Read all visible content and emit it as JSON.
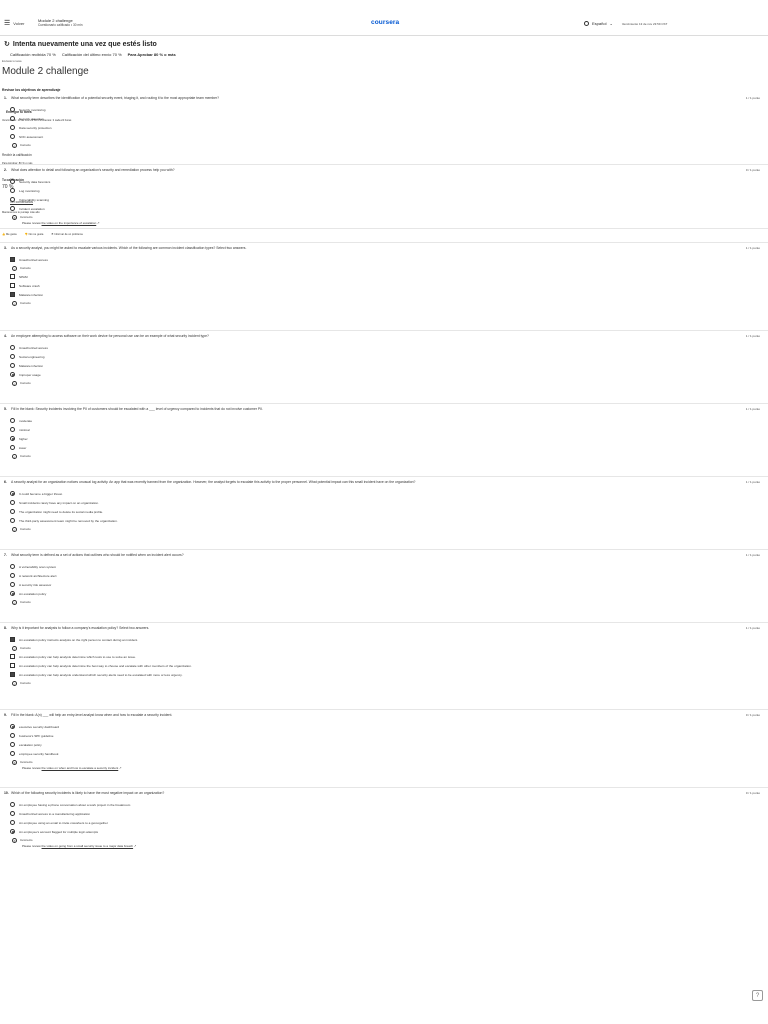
{
  "header": {
    "back_label": "Volver",
    "course_title": "Module 2 challenge",
    "course_sub": "Cuestionario calificado • 30 min",
    "logo": "coursera",
    "language": "Español",
    "language_small": "Vencimiento 13 de nov 23:59 CST"
  },
  "banner": {
    "title": "Intenta nuevamente una vez que estés listo",
    "received_label": "Calificación recibida 70 %",
    "latest_label": "Calificación del último envío 70 %",
    "pass_label": "Para Aprobar 80 % o más"
  },
  "mini_label": "Enviaste tu tarea",
  "page_title": "Module 2 challenge",
  "objectives": "Revisar los objetivos de aprendizaje",
  "overlay": {
    "o1": "Entregar tu tarea",
    "o2": "Vencimiento: 13 de nov. 23:59 CST",
    "o3": "Intentos: 3 cada 24 horas",
    "o4": "Recibir la calificación",
    "o5": "Tu calificación",
    "o6": "Para Aprobar: 80 % o más",
    "o7": "70 %",
    "o8": "Ver comentarios",
    "o9": "Mantenemos tu puntaje más alto",
    "like": "Me gusta",
    "dislike": "No me gusta",
    "report": "Informar de un problema"
  },
  "questions": [
    {
      "num": "1.",
      "text": "What security term describes the identification of a potential security event, triaging it, and routing it to the most appropriate team member?",
      "points": "1 / 1 punto",
      "type": "radio",
      "options": [
        {
          "label": "Security monitoring",
          "selected": false
        },
        {
          "label": "Security detection",
          "selected": false
        },
        {
          "label": "Data security protection",
          "selected": false
        },
        {
          "label": "SOC assessment",
          "selected": false
        }
      ],
      "feedback": "Correcto",
      "review": ""
    },
    {
      "num": "2.",
      "text": "What does attention to detail and following an organization's security and remediation process help you with?",
      "points": "0 / 1 punto",
      "type": "radio",
      "options": [
        {
          "label": "Security data forensics",
          "selected": false
        },
        {
          "label": "Log monitoring",
          "selected": false
        },
        {
          "label": "Vulnerability scanning",
          "selected": false
        },
        {
          "label": "Incident escalation",
          "selected": false
        }
      ],
      "feedback": "Incorrecto",
      "review": "Please review",
      "review_link": "the video on the importance of escalation"
    },
    {
      "num": "3.",
      "text": "As a security analyst, you might be asked to escalate various incidents. Which of the following are common incident classification types? Select two answers.",
      "points": "1 / 1 punto",
      "type": "check",
      "options": [
        {
          "label": "Unauthorized access",
          "selected": true,
          "feedback": "Correcto"
        },
        {
          "label": "SPAM",
          "selected": false
        },
        {
          "label": "Software crash",
          "selected": false
        },
        {
          "label": "Malware infection",
          "selected": true,
          "feedback": "Correcto"
        }
      ]
    },
    {
      "num": "4.",
      "text": "An employee attempting to access software on their work device for personal use can be an example of what security incident type?",
      "points": "1 / 1 punto",
      "type": "radio",
      "options": [
        {
          "label": "Unauthorized access",
          "selected": false
        },
        {
          "label": "Social engineering",
          "selected": false
        },
        {
          "label": "Malware infection",
          "selected": false
        },
        {
          "label": "Improper usage",
          "selected": true
        }
      ],
      "feedback": "Correcto",
      "review": ""
    },
    {
      "num": "5.",
      "text": "Fill in the blank: Security incidents involving the PII of customers should be escalated with a ___ level of urgency compared to incidents that do not involve customer PII.",
      "points": "1 / 1 punto",
      "type": "radio",
      "options": [
        {
          "label": "moderate",
          "selected": false
        },
        {
          "label": "minimal",
          "selected": false
        },
        {
          "label": "higher",
          "selected": true
        },
        {
          "label": "lower",
          "selected": false
        }
      ],
      "feedback": "Correcto",
      "review": ""
    },
    {
      "num": "6.",
      "text": "A security analyst for an organization notices unusual log activity. An app that was recently banned from the organization. However, the analyst forgets to escalate this activity to the proper personnel. What potential impact can this small incident have on the organization?",
      "points": "1 / 1 punto",
      "type": "radio",
      "options": [
        {
          "label": "It could become a bigger threat.",
          "selected": true
        },
        {
          "label": "Small incidents rarely have any impact on an organization.",
          "selected": false
        },
        {
          "label": "The organization might need to delete its social media profile.",
          "selected": false
        },
        {
          "label": "The third-party assessment team might be removed by the organization.",
          "selected": false
        }
      ],
      "feedback": "Correcto",
      "review": ""
    },
    {
      "num": "7.",
      "text": "What security term is defined as a set of actions that outlines who should be notified when an incident alert occurs?",
      "points": "1 / 1 punto",
      "type": "radio",
      "options": [
        {
          "label": "A vulnerability scan system",
          "selected": false
        },
        {
          "label": "A network architecture alert",
          "selected": false
        },
        {
          "label": "A security risk assessor",
          "selected": false
        },
        {
          "label": "An escalation policy",
          "selected": true
        }
      ],
      "feedback": "Correcto",
      "review": ""
    },
    {
      "num": "8.",
      "text": "Why is it important for analysts to follow a company's escalation policy? Select two answers.",
      "points": "1 / 1 punto",
      "type": "check",
      "options": [
        {
          "label": "An escalation policy instructs analysts on the right person to contact during an incident.",
          "selected": true,
          "feedback": "Correcto"
        },
        {
          "label": "An escalation policy can help analysts determine which tools to use to solve an issue.",
          "selected": false
        },
        {
          "label": "An escalation policy can help analysts determine the best way to choose and escalate with other members of the organization.",
          "selected": false
        },
        {
          "label": "An escalation policy can help analysts understand which security alerts need to be escalated with more or less urgency.",
          "selected": true,
          "feedback": "Correcto"
        }
      ]
    },
    {
      "num": "9.",
      "text": "Fill in the blank: A(n) ___ will help an entry-level analyst know when and how to escalate a security incident.",
      "points": "0 / 1 punto",
      "type": "radio",
      "options": [
        {
          "label": "executive security dashboard",
          "selected": true
        },
        {
          "label": "business's SPF guideline",
          "selected": false
        },
        {
          "label": "escalation policy",
          "selected": false
        },
        {
          "label": "employee security handbook",
          "selected": false
        }
      ],
      "feedback": "Incorrecto",
      "review": "Please review",
      "review_link": "the video on when and how to escalate a security incident"
    },
    {
      "num": "10.",
      "text": "Which of the following security incidents is likely to have the most negative impact on an organization?",
      "points": "0 / 1 punto",
      "type": "radio",
      "options": [
        {
          "label": "An employee having a phone conversation about a work project in the breakroom",
          "selected": false
        },
        {
          "label": "Unauthorized access to a manufacturing application",
          "selected": false
        },
        {
          "label": "An employee using an email to invite coworkers to a get-together",
          "selected": false
        },
        {
          "label": "An employee's account flagged for multiple login attempts",
          "selected": true
        }
      ],
      "feedback": "Incorrecto",
      "review": "Please review",
      "review_link": "the video on going from a small security issue to a major data breach"
    }
  ]
}
